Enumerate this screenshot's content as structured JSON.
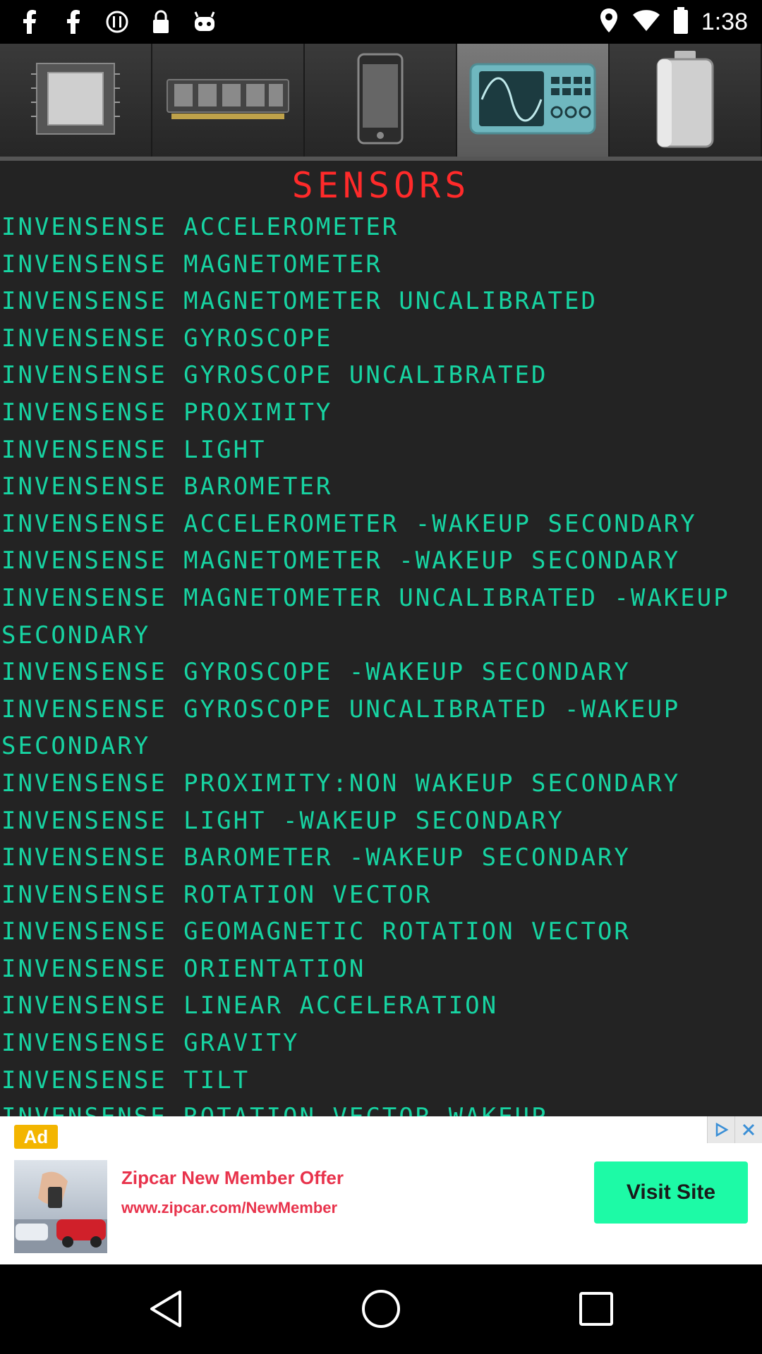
{
  "status_bar": {
    "time": "1:38",
    "left_icons": [
      "facebook-icon",
      "facebook-icon",
      "info-icon",
      "lock-icon",
      "android-icon"
    ],
    "right_icons": [
      "location-icon",
      "wifi-icon",
      "battery-icon"
    ]
  },
  "tabs": [
    {
      "icon": "cpu-chip-icon",
      "active": false
    },
    {
      "icon": "memory-ram-icon",
      "active": false
    },
    {
      "icon": "phone-device-icon",
      "active": false
    },
    {
      "icon": "sensors-oscilloscope-icon",
      "active": true
    },
    {
      "icon": "battery-icon",
      "active": false
    }
  ],
  "section_title": "SENSORS",
  "sensors": [
    "INVENSENSE ACCELEROMETER",
    "INVENSENSE MAGNETOMETER",
    "INVENSENSE MAGNETOMETER UNCALIBRATED",
    "INVENSENSE GYROSCOPE",
    "INVENSENSE GYROSCOPE UNCALIBRATED",
    "INVENSENSE PROXIMITY",
    "INVENSENSE LIGHT",
    "INVENSENSE BAROMETER",
    "INVENSENSE ACCELEROMETER -WAKEUP SECONDARY",
    "INVENSENSE MAGNETOMETER -WAKEUP SECONDARY",
    "INVENSENSE MAGNETOMETER UNCALIBRATED -WAKEUP SECONDARY",
    "INVENSENSE GYROSCOPE -WAKEUP SECONDARY",
    "INVENSENSE GYROSCOPE UNCALIBRATED -WAKEUP SECONDARY",
    "INVENSENSE PROXIMITY:NON WAKEUP SECONDARY",
    "INVENSENSE LIGHT -WAKEUP SECONDARY",
    "INVENSENSE BAROMETER -WAKEUP SECONDARY",
    "INVENSENSE ROTATION VECTOR",
    "INVENSENSE GEOMAGNETIC ROTATION VECTOR",
    "INVENSENSE ORIENTATION",
    "INVENSENSE LINEAR ACCELERATION",
    "INVENSENSE GRAVITY",
    "INVENSENSE TILT",
    "INVENSENSE ROTATION VECTOR-WAKEUP"
  ],
  "ad": {
    "badge": "Ad",
    "headline": "Zipcar New Member Offer",
    "url": "www.zipcar.com/NewMember",
    "cta": "Visit Site"
  },
  "colors": {
    "title": "#ff2a2a",
    "list_text": "#17d4a2",
    "content_bg": "#232323",
    "ad_cta_bg": "#1dfaa6",
    "ad_text": "#e8334c"
  }
}
